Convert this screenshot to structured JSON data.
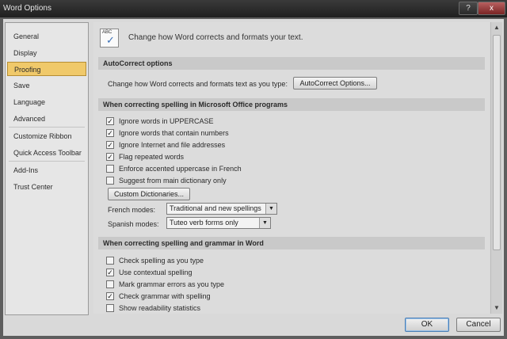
{
  "window": {
    "title": "Word Options",
    "help_icon": "?",
    "close_icon": "x"
  },
  "nav": {
    "items": [
      {
        "label": "General"
      },
      {
        "label": "Display"
      },
      {
        "label": "Proofing"
      },
      {
        "label": "Save"
      },
      {
        "label": "Language"
      },
      {
        "label": "Advanced"
      },
      {
        "label": "Customize Ribbon"
      },
      {
        "label": "Quick Access Toolbar"
      },
      {
        "label": "Add-Ins"
      },
      {
        "label": "Trust Center"
      }
    ],
    "selected": "Proofing"
  },
  "header": {
    "icon": "abc-check-icon",
    "icon_text": "ABC",
    "text": "Change how Word corrects and formats your text."
  },
  "autocorrect": {
    "title": "AutoCorrect options",
    "description": "Change how Word corrects and formats text as you type:",
    "button": "AutoCorrect Options..."
  },
  "spelling_office": {
    "title": "When correcting spelling in Microsoft Office programs",
    "options": [
      {
        "label": "Ignore words in UPPERCASE",
        "checked": true
      },
      {
        "label": "Ignore words that contain numbers",
        "checked": true
      },
      {
        "label": "Ignore Internet and file addresses",
        "checked": true
      },
      {
        "label": "Flag repeated words",
        "checked": true
      },
      {
        "label": "Enforce accented uppercase in French",
        "checked": false
      },
      {
        "label": "Suggest from main dictionary only",
        "checked": false
      }
    ],
    "custom_dict_button": "Custom Dictionaries...",
    "french_label": "French modes:",
    "french_value": "Traditional and new spellings",
    "spanish_label": "Spanish modes:",
    "spanish_value": "Tuteo verb forms only"
  },
  "spelling_word": {
    "title": "When correcting spelling and grammar in Word",
    "options": [
      {
        "label": "Check spelling as you type",
        "checked": false
      },
      {
        "label": "Use contextual spelling",
        "checked": true
      },
      {
        "label": "Mark grammar errors as you type",
        "checked": false
      },
      {
        "label": "Check grammar with spelling",
        "checked": true
      },
      {
        "label": "Show readability statistics",
        "checked": false
      }
    ]
  },
  "footer": {
    "ok": "OK",
    "cancel": "Cancel"
  },
  "check_mark": "✓",
  "colors": {
    "selected_nav": "#f0c96a",
    "ok_border": "#4a7fb6"
  }
}
